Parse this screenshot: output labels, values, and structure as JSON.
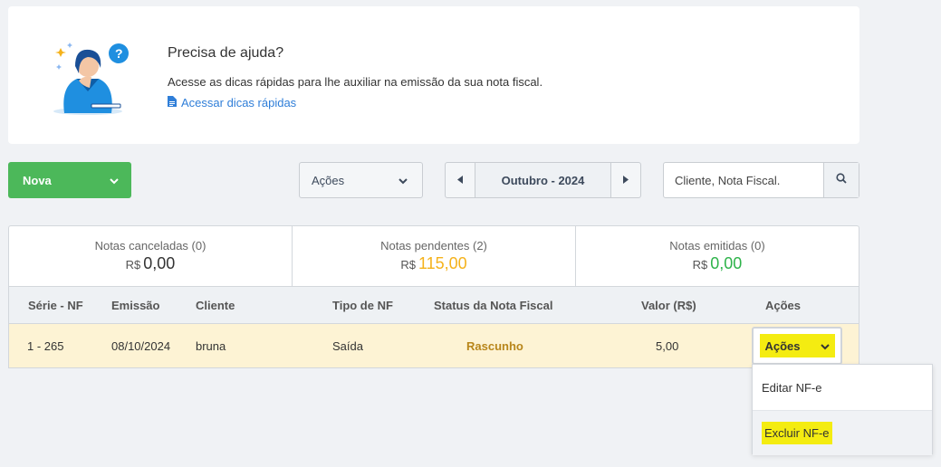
{
  "help": {
    "title": "Precisa de ajuda?",
    "text": "Acesse as dicas rápidas para lhe auxiliar na emissão da sua nota fiscal.",
    "link": "Acessar dicas rápidas"
  },
  "toolbar": {
    "nova_label": "Nova",
    "acoes_label": "Ações",
    "month_label": "Outubro - 2024",
    "search_placeholder": "Cliente, Nota Fiscal."
  },
  "summary": {
    "canceladas": {
      "label": "Notas canceladas (0)",
      "currency": "R$",
      "value": "0,00",
      "color": "#333333"
    },
    "pendentes": {
      "label": "Notas pendentes (2)",
      "currency": "R$",
      "value": "115,00",
      "color": "#f5b21b"
    },
    "emitidas": {
      "label": "Notas emitidas (0)",
      "currency": "R$",
      "value": "0,00",
      "color": "#2eb34a"
    }
  },
  "table": {
    "headers": {
      "serie": "Série - NF",
      "emissao": "Emissão",
      "cliente": "Cliente",
      "tipo": "Tipo de NF",
      "status": "Status da Nota Fiscal",
      "valor": "Valor (R$)",
      "acoes": "Ações"
    },
    "rows": [
      {
        "serie": "1 - 265",
        "emissao": "08/10/2024",
        "cliente": "bruna",
        "tipo": "Saída",
        "status": "Rascunho",
        "valor": "5,00",
        "acoes_label": "Ações"
      }
    ]
  },
  "row_menu": {
    "items": [
      "Editar NF-e",
      "Excluir NF-e"
    ]
  },
  "colors": {
    "primary_green": "#4cb85a",
    "highlight_yellow": "#f4ec11",
    "row_highlight": "#fdf3d4",
    "status_draft": "#b8861b",
    "link_blue": "#2f7ed8"
  }
}
